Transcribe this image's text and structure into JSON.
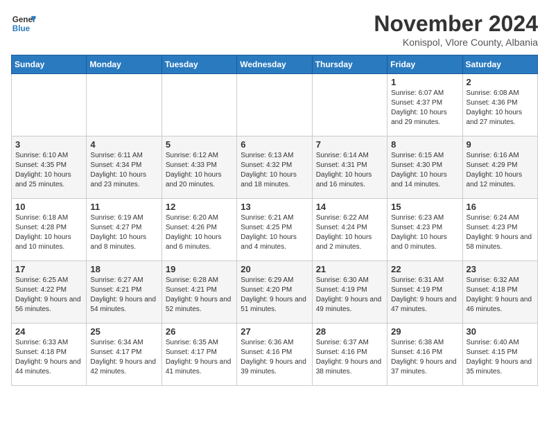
{
  "logo": {
    "line1": "General",
    "line2": "Blue"
  },
  "title": "November 2024",
  "location": "Konispol, Vlore County, Albania",
  "days_header": [
    "Sunday",
    "Monday",
    "Tuesday",
    "Wednesday",
    "Thursday",
    "Friday",
    "Saturday"
  ],
  "weeks": [
    [
      {
        "day": "",
        "info": ""
      },
      {
        "day": "",
        "info": ""
      },
      {
        "day": "",
        "info": ""
      },
      {
        "day": "",
        "info": ""
      },
      {
        "day": "",
        "info": ""
      },
      {
        "day": "1",
        "info": "Sunrise: 6:07 AM\nSunset: 4:37 PM\nDaylight: 10 hours and 29 minutes."
      },
      {
        "day": "2",
        "info": "Sunrise: 6:08 AM\nSunset: 4:36 PM\nDaylight: 10 hours and 27 minutes."
      }
    ],
    [
      {
        "day": "3",
        "info": "Sunrise: 6:10 AM\nSunset: 4:35 PM\nDaylight: 10 hours and 25 minutes."
      },
      {
        "day": "4",
        "info": "Sunrise: 6:11 AM\nSunset: 4:34 PM\nDaylight: 10 hours and 23 minutes."
      },
      {
        "day": "5",
        "info": "Sunrise: 6:12 AM\nSunset: 4:33 PM\nDaylight: 10 hours and 20 minutes."
      },
      {
        "day": "6",
        "info": "Sunrise: 6:13 AM\nSunset: 4:32 PM\nDaylight: 10 hours and 18 minutes."
      },
      {
        "day": "7",
        "info": "Sunrise: 6:14 AM\nSunset: 4:31 PM\nDaylight: 10 hours and 16 minutes."
      },
      {
        "day": "8",
        "info": "Sunrise: 6:15 AM\nSunset: 4:30 PM\nDaylight: 10 hours and 14 minutes."
      },
      {
        "day": "9",
        "info": "Sunrise: 6:16 AM\nSunset: 4:29 PM\nDaylight: 10 hours and 12 minutes."
      }
    ],
    [
      {
        "day": "10",
        "info": "Sunrise: 6:18 AM\nSunset: 4:28 PM\nDaylight: 10 hours and 10 minutes."
      },
      {
        "day": "11",
        "info": "Sunrise: 6:19 AM\nSunset: 4:27 PM\nDaylight: 10 hours and 8 minutes."
      },
      {
        "day": "12",
        "info": "Sunrise: 6:20 AM\nSunset: 4:26 PM\nDaylight: 10 hours and 6 minutes."
      },
      {
        "day": "13",
        "info": "Sunrise: 6:21 AM\nSunset: 4:25 PM\nDaylight: 10 hours and 4 minutes."
      },
      {
        "day": "14",
        "info": "Sunrise: 6:22 AM\nSunset: 4:24 PM\nDaylight: 10 hours and 2 minutes."
      },
      {
        "day": "15",
        "info": "Sunrise: 6:23 AM\nSunset: 4:23 PM\nDaylight: 10 hours and 0 minutes."
      },
      {
        "day": "16",
        "info": "Sunrise: 6:24 AM\nSunset: 4:23 PM\nDaylight: 9 hours and 58 minutes."
      }
    ],
    [
      {
        "day": "17",
        "info": "Sunrise: 6:25 AM\nSunset: 4:22 PM\nDaylight: 9 hours and 56 minutes."
      },
      {
        "day": "18",
        "info": "Sunrise: 6:27 AM\nSunset: 4:21 PM\nDaylight: 9 hours and 54 minutes."
      },
      {
        "day": "19",
        "info": "Sunrise: 6:28 AM\nSunset: 4:21 PM\nDaylight: 9 hours and 52 minutes."
      },
      {
        "day": "20",
        "info": "Sunrise: 6:29 AM\nSunset: 4:20 PM\nDaylight: 9 hours and 51 minutes."
      },
      {
        "day": "21",
        "info": "Sunrise: 6:30 AM\nSunset: 4:19 PM\nDaylight: 9 hours and 49 minutes."
      },
      {
        "day": "22",
        "info": "Sunrise: 6:31 AM\nSunset: 4:19 PM\nDaylight: 9 hours and 47 minutes."
      },
      {
        "day": "23",
        "info": "Sunrise: 6:32 AM\nSunset: 4:18 PM\nDaylight: 9 hours and 46 minutes."
      }
    ],
    [
      {
        "day": "24",
        "info": "Sunrise: 6:33 AM\nSunset: 4:18 PM\nDaylight: 9 hours and 44 minutes."
      },
      {
        "day": "25",
        "info": "Sunrise: 6:34 AM\nSunset: 4:17 PM\nDaylight: 9 hours and 42 minutes."
      },
      {
        "day": "26",
        "info": "Sunrise: 6:35 AM\nSunset: 4:17 PM\nDaylight: 9 hours and 41 minutes."
      },
      {
        "day": "27",
        "info": "Sunrise: 6:36 AM\nSunset: 4:16 PM\nDaylight: 9 hours and 39 minutes."
      },
      {
        "day": "28",
        "info": "Sunrise: 6:37 AM\nSunset: 4:16 PM\nDaylight: 9 hours and 38 minutes."
      },
      {
        "day": "29",
        "info": "Sunrise: 6:38 AM\nSunset: 4:16 PM\nDaylight: 9 hours and 37 minutes."
      },
      {
        "day": "30",
        "info": "Sunrise: 6:40 AM\nSunset: 4:15 PM\nDaylight: 9 hours and 35 minutes."
      }
    ]
  ]
}
